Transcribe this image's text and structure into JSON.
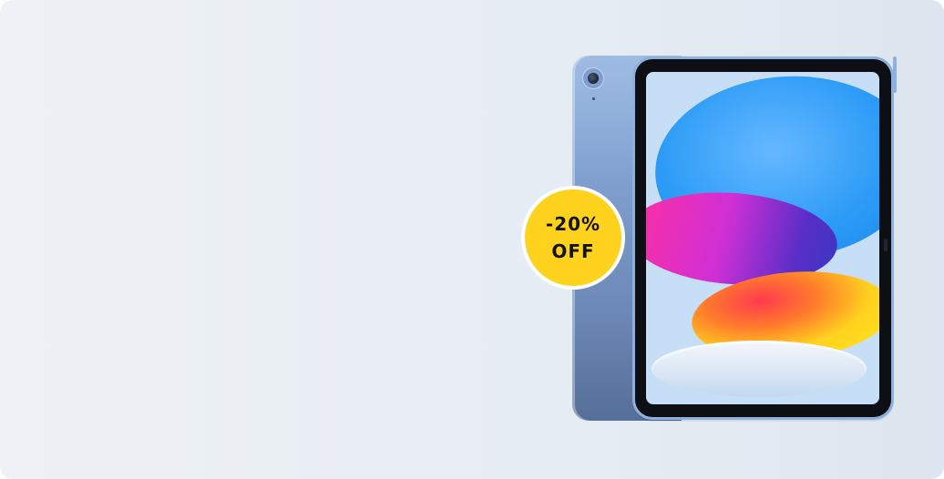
{
  "banner": {
    "background_colors": [
      "#eef1f5",
      "#e7edf4",
      "#dde6f0"
    ]
  },
  "product": {
    "image_icon": "tablet-device-icon",
    "device_color": "#8fb0dd"
  },
  "discount_badge": {
    "line1": "-20%",
    "line2": "OFF",
    "color": "#ffd21e"
  }
}
